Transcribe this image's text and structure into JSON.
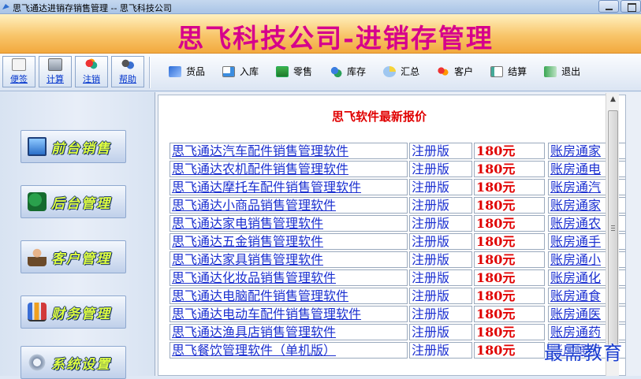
{
  "window": {
    "title": "思飞通达进销存销售管理 -- 思飞科技公司"
  },
  "banner": {
    "title": "思飞科技公司-进销存管理"
  },
  "quick_buttons": [
    {
      "label": "便签",
      "icon": "notepad-icon"
    },
    {
      "label": "计算",
      "icon": "calculator-icon"
    },
    {
      "label": "注销",
      "icon": "logout-users-icon"
    },
    {
      "label": "帮助",
      "icon": "help-users-icon"
    }
  ],
  "menu": [
    {
      "label": "货品",
      "icon": "goods-icon"
    },
    {
      "label": "入库",
      "icon": "stock-in-icon"
    },
    {
      "label": "零售",
      "icon": "retail-icon"
    },
    {
      "label": "库存",
      "icon": "inventory-icon"
    },
    {
      "label": "汇总",
      "icon": "summary-icon"
    },
    {
      "label": "客户",
      "icon": "customer-icon"
    },
    {
      "label": "结算",
      "icon": "settlement-icon"
    },
    {
      "label": "退出",
      "icon": "exit-icon"
    }
  ],
  "sidebar": [
    {
      "label": "前台销售",
      "icon": "monitor-icon"
    },
    {
      "label": "后台管理",
      "icon": "admin-icon"
    },
    {
      "label": "客户管理",
      "icon": "person-icon"
    },
    {
      "label": "财务管理",
      "icon": "chart-icon"
    },
    {
      "label": "系统设置",
      "icon": "gear-icon"
    }
  ],
  "content": {
    "title": "思飞软件最新报价",
    "rows": [
      {
        "name": "思飞通达汽车配件销售管理软件",
        "edition": "注册版",
        "price": "180元",
        "related": "账房通家"
      },
      {
        "name": "思飞通达农机配件销售管理软件",
        "edition": "注册版",
        "price": "180元",
        "related": "账房通电"
      },
      {
        "name": "思飞通达摩托车配件销售管理软件",
        "edition": "注册版",
        "price": "180元",
        "related": "账房通汽"
      },
      {
        "name": "思飞通达小商品销售管理软件",
        "edition": "注册版",
        "price": "180元",
        "related": "账房通家"
      },
      {
        "name": "思飞通达家电销售管理软件",
        "edition": "注册版",
        "price": "180元",
        "related": "账房通农"
      },
      {
        "name": "思飞通达五金销售管理软件",
        "edition": "注册版",
        "price": "180元",
        "related": "账房通手"
      },
      {
        "name": "思飞通达家具销售管理软件",
        "edition": "注册版",
        "price": "180元",
        "related": "账房通小"
      },
      {
        "name": "思飞通达化妆品销售管理软件",
        "edition": "注册版",
        "price": "180元",
        "related": "账房通化"
      },
      {
        "name": "思飞通达电脑配件销售管理软件",
        "edition": "注册版",
        "price": "180元",
        "related": "账房通食"
      },
      {
        "name": "思飞通达电动车配件销售管理软件",
        "edition": "注册版",
        "price": "180元",
        "related": "账房通医"
      },
      {
        "name": "思飞通达渔具店销售管理软件",
        "edition": "注册版",
        "price": "180元",
        "related": "账房通药"
      },
      {
        "name": "思飞餐饮管理软件（单机版）",
        "edition": "注册版",
        "price": "180元",
        "related": "账房通卫"
      }
    ]
  },
  "watermark": "最需教育",
  "colors": {
    "banner_title": "#d6008c",
    "price": "#e00000",
    "link": "#1a2fd0",
    "sidebar_label": "#e0ff40"
  }
}
